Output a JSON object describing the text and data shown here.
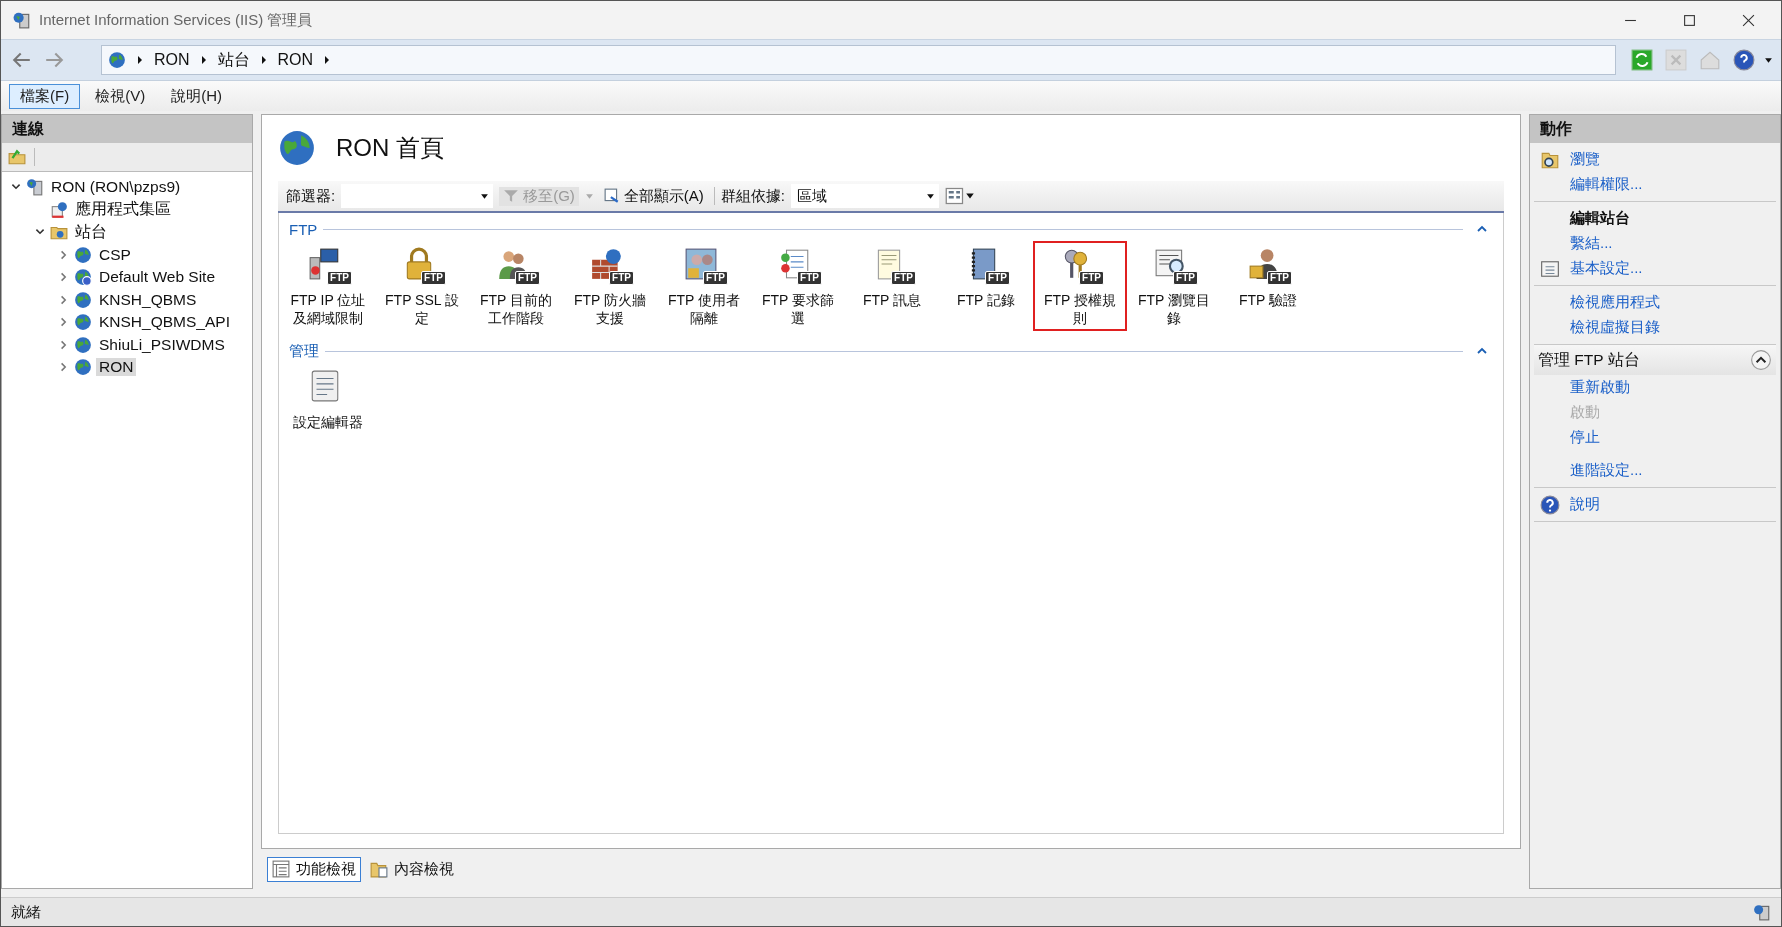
{
  "window": {
    "title": "Internet Information Services (IIS) 管理員"
  },
  "breadcrumb": [
    "RON",
    "站台",
    "RON"
  ],
  "menu": [
    {
      "label": "檔案(F)",
      "selected": true
    },
    {
      "label": "檢視(V)",
      "selected": false
    },
    {
      "label": "說明(H)",
      "selected": false
    }
  ],
  "connections": {
    "title": "連線",
    "tree": [
      {
        "label": "RON (RON\\pzps9)",
        "kind": "server",
        "expanded": true,
        "selected": false,
        "children": [
          {
            "label": "應用程式集區",
            "kind": "apppool",
            "selected": false
          },
          {
            "label": "站台",
            "kind": "sites",
            "expanded": true,
            "selected": false,
            "children": [
              {
                "label": "CSP",
                "kind": "globe",
                "expanded": false,
                "selected": false
              },
              {
                "label": "Default Web Site",
                "kind": "globe-help",
                "expanded": false,
                "selected": false
              },
              {
                "label": "KNSH_QBMS",
                "kind": "globe",
                "expanded": false,
                "selected": false
              },
              {
                "label": "KNSH_QBMS_API",
                "kind": "globe",
                "expanded": false,
                "selected": false
              },
              {
                "label": "ShiuLi_PSIWDMS",
                "kind": "globe",
                "expanded": false,
                "selected": false
              },
              {
                "label": "RON",
                "kind": "globe",
                "expanded": false,
                "selected": true
              }
            ]
          }
        ]
      }
    ]
  },
  "home": {
    "title": "RON 首頁",
    "filter": {
      "label": "篩選器:",
      "go": "移至(G)",
      "go_disabled": true,
      "show_all": "全部顯示(A)",
      "group_label": "群組依據:",
      "group_value": "區域"
    },
    "groups": [
      {
        "title": "FTP",
        "items": [
          {
            "label": "FTP IP 位址及網域限制",
            "kind": "monitor",
            "badge": "FTP",
            "highlighted": false
          },
          {
            "label": "FTP SSL 設定",
            "kind": "padlock",
            "badge": "FTP",
            "highlighted": false
          },
          {
            "label": "FTP 目前的工作階段",
            "kind": "people",
            "badge": "FTP",
            "highlighted": false
          },
          {
            "label": "FTP 防火牆支援",
            "kind": "wall",
            "badge": "FTP",
            "highlighted": false
          },
          {
            "label": "FTP 使用者隔離",
            "kind": "userlock",
            "badge": "FTP",
            "highlighted": false
          },
          {
            "label": "FTP 要求篩選",
            "kind": "document",
            "badge": "FTP",
            "highlighted": false
          },
          {
            "label": "FTP 訊息",
            "kind": "notepad",
            "badge": "FTP",
            "highlighted": false
          },
          {
            "label": "FTP 記錄",
            "kind": "notebook",
            "badge": "FTP",
            "highlighted": false
          },
          {
            "label": "FTP 授權規則",
            "kind": "keys",
            "badge": "FTP",
            "highlighted": true
          },
          {
            "label": "FTP 瀏覽目錄",
            "kind": "browse",
            "badge": "FTP",
            "highlighted": false
          },
          {
            "label": "FTP 驗證",
            "kind": "user",
            "badge": "FTP",
            "highlighted": false
          }
        ]
      },
      {
        "title": "管理",
        "items": [
          {
            "label": "設定編輯器",
            "kind": "config",
            "highlighted": false
          }
        ]
      }
    ]
  },
  "tabs": [
    {
      "label": "功能檢視",
      "kind": "features",
      "selected": true
    },
    {
      "label": "內容檢視",
      "kind": "content",
      "selected": false
    }
  ],
  "actions": {
    "title": "動作",
    "sections": [
      {
        "kind": "plain",
        "items": [
          {
            "label": "瀏覽",
            "kind": "browse",
            "disabled": false
          },
          {
            "label": "編輯權限...",
            "kind": "link",
            "disabled": false
          }
        ]
      },
      {
        "kind": "plain",
        "heading": "編輯站台",
        "items": [
          {
            "label": "繫結...",
            "kind": "link",
            "disabled": false
          },
          {
            "label": "基本設定...",
            "kind": "settings",
            "disabled": false
          }
        ]
      },
      {
        "kind": "plain",
        "items": [
          {
            "label": "檢視應用程式",
            "kind": "link",
            "disabled": false
          },
          {
            "label": "檢視虛擬目錄",
            "kind": "link",
            "disabled": false
          }
        ]
      },
      {
        "kind": "group",
        "heading": "管理 FTP 站台",
        "items": [
          {
            "label": "重新啟動",
            "kind": "link",
            "disabled": false
          },
          {
            "label": "啟動",
            "kind": "link",
            "disabled": true
          },
          {
            "label": "停止",
            "kind": "link",
            "disabled": false
          }
        ]
      },
      {
        "kind": "plain",
        "items": [
          {
            "label": "進階設定...",
            "kind": "link",
            "disabled": false
          }
        ]
      },
      {
        "kind": "plain",
        "items": [
          {
            "label": "說明",
            "kind": "help",
            "disabled": false
          }
        ]
      }
    ]
  },
  "status_bar": {
    "text": "就緒"
  }
}
